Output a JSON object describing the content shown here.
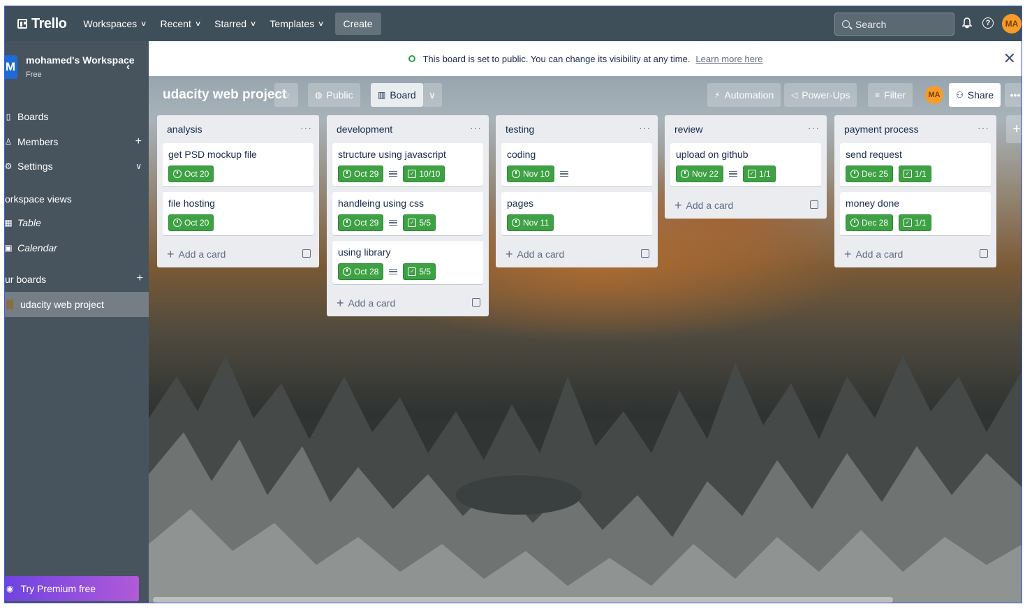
{
  "topbar": {
    "logo": "Trello",
    "nav": [
      "Workspaces",
      "Recent",
      "Starred",
      "Templates"
    ],
    "create": "Create",
    "search_placeholder": "Search",
    "avatar_initials": "MA"
  },
  "sidebar": {
    "workspace_initial": "M",
    "workspace_name": "mohamed's Workspace",
    "workspace_plan": "Free",
    "items": [
      {
        "label": "Boards"
      },
      {
        "label": "Members"
      },
      {
        "label": "Settings"
      }
    ],
    "views_heading": "orkspace views",
    "views": [
      {
        "label": "Table"
      },
      {
        "label": "Calendar"
      }
    ],
    "boards_heading": "ur boards",
    "boards": [
      {
        "label": "udacity web project"
      }
    ],
    "premium": "Try Premium free"
  },
  "notice": {
    "text": "This board is set to public. You can change its visibility at any time.",
    "link": "Learn more here"
  },
  "board": {
    "title": "udacity web project",
    "visibility": "Public",
    "view": "Board",
    "automation": "Automation",
    "powerups": "Power-Ups",
    "filter": "Filter",
    "member_initials": "MA",
    "share": "Share"
  },
  "lists": [
    {
      "name": "analysis",
      "cards": [
        {
          "title": "get PSD mockup file",
          "due": "Oct 20",
          "description": false,
          "checklist": ""
        },
        {
          "title": "file hosting",
          "due": "Oct 20",
          "description": false,
          "checklist": ""
        }
      ]
    },
    {
      "name": "development",
      "cards": [
        {
          "title": "structure using javascript",
          "due": "Oct 29",
          "description": true,
          "checklist": "10/10"
        },
        {
          "title": "handleing using css",
          "due": "Oct 29",
          "description": true,
          "checklist": "5/5"
        },
        {
          "title": "using library",
          "due": "Oct 28",
          "description": true,
          "checklist": "5/5"
        }
      ]
    },
    {
      "name": "testing",
      "cards": [
        {
          "title": "coding",
          "due": "Nov 10",
          "description": true,
          "checklist": ""
        },
        {
          "title": "pages",
          "due": "Nov 11",
          "description": false,
          "checklist": ""
        }
      ]
    },
    {
      "name": "review",
      "cards": [
        {
          "title": "upload on github",
          "due": "Nov 22",
          "description": true,
          "checklist": "1/1"
        }
      ]
    },
    {
      "name": "payment process",
      "cards": [
        {
          "title": "send request",
          "due": "Dec 25",
          "description": false,
          "checklist": "1/1"
        },
        {
          "title": "money done",
          "due": "Dec 28",
          "description": false,
          "checklist": "1/1"
        }
      ]
    }
  ],
  "add_card_label": "Add a card",
  "colors": {
    "topbar": "#3e4f5a",
    "badge_green": "#3ea144",
    "workspace_blue": "#1f6bd6",
    "avatar_orange": "#f79c2a"
  }
}
